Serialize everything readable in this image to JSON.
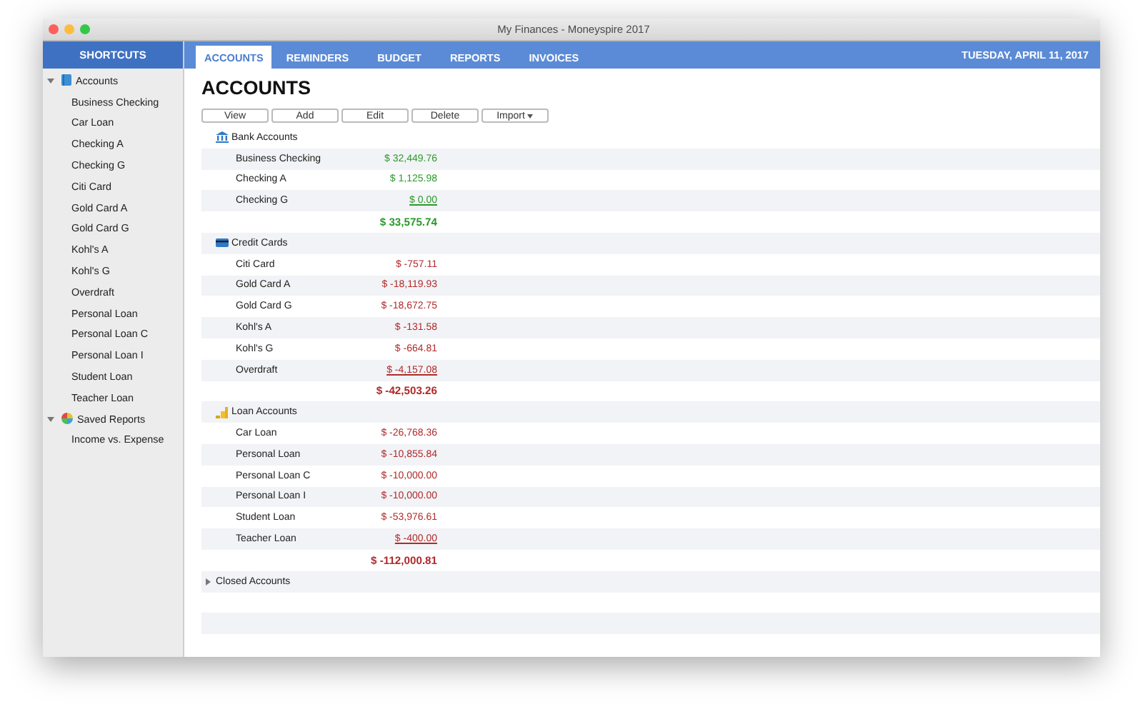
{
  "window": {
    "title": "My Finances - Moneyspire 2017"
  },
  "sidebar": {
    "header": "SHORTCUTS",
    "items": [
      {
        "label": "Accounts",
        "expanded": true,
        "children": [
          {
            "label": "Business Checking"
          },
          {
            "label": "Car Loan"
          },
          {
            "label": "Checking A"
          },
          {
            "label": "Checking G"
          },
          {
            "label": "Citi Card"
          },
          {
            "label": "Gold Card A"
          },
          {
            "label": "Gold Card G"
          },
          {
            "label": "Kohl's A"
          },
          {
            "label": "Kohl's G"
          },
          {
            "label": "Overdraft"
          },
          {
            "label": "Personal Loan"
          },
          {
            "label": "Personal Loan C"
          },
          {
            "label": "Personal Loan I"
          },
          {
            "label": "Student Loan"
          },
          {
            "label": "Teacher Loan"
          }
        ]
      },
      {
        "label": "Saved Reports",
        "expanded": true,
        "children": [
          {
            "label": "Income vs. Expense"
          }
        ]
      }
    ]
  },
  "tabs": [
    {
      "label": "ACCOUNTS",
      "selected": true
    },
    {
      "label": "REMINDERS",
      "selected": false
    },
    {
      "label": "BUDGET",
      "selected": false
    },
    {
      "label": "REPORTS",
      "selected": false
    },
    {
      "label": "INVOICES",
      "selected": false
    }
  ],
  "date": "TUESDAY, APRIL 11, 2017",
  "heading": "ACCOUNTS",
  "buttons": [
    {
      "label": "View",
      "kind": "plain"
    },
    {
      "label": "Add",
      "kind": "plain"
    },
    {
      "label": "Edit",
      "kind": "plain"
    },
    {
      "label": "Delete",
      "kind": "plain"
    },
    {
      "label": "Import",
      "kind": "menu"
    }
  ],
  "groups": [
    {
      "name": "Bank Accounts",
      "expanded": true,
      "total": "$ 33,575.74",
      "color": "#2a9a2a",
      "accounts": [
        {
          "name": "Business Checking",
          "amount": "$ 32,449.76",
          "underlined": false
        },
        {
          "name": "Checking A",
          "amount": "$ 1,125.98",
          "underlined": false
        },
        {
          "name": "Checking G",
          "amount": "$ 0.00",
          "underlined": true
        }
      ]
    },
    {
      "name": "Credit Cards",
      "expanded": true,
      "total": "$ -42,503.26",
      "color": "#b02a2a",
      "accounts": [
        {
          "name": "Citi Card",
          "amount": "$ -757.11",
          "underlined": false
        },
        {
          "name": "Gold Card A",
          "amount": "$ -18,119.93",
          "underlined": false
        },
        {
          "name": "Gold Card G",
          "amount": "$ -18,672.75",
          "underlined": false
        },
        {
          "name": "Kohl's A",
          "amount": "$ -131.58",
          "underlined": false
        },
        {
          "name": "Kohl's G",
          "amount": "$ -664.81",
          "underlined": false
        },
        {
          "name": "Overdraft",
          "amount": "$ -4,157.08",
          "underlined": true
        }
      ]
    },
    {
      "name": "Loan Accounts",
      "expanded": true,
      "total": "$ -112,000.81",
      "color": "#b02a2a",
      "accounts": [
        {
          "name": "Car Loan",
          "amount": "$ -26,768.36",
          "underlined": false
        },
        {
          "name": "Personal Loan",
          "amount": "$ -10,855.84",
          "underlined": false
        },
        {
          "name": "Personal Loan C",
          "amount": "$ -10,000.00",
          "underlined": false
        },
        {
          "name": "Personal Loan I",
          "amount": "$ -10,000.00",
          "underlined": false
        },
        {
          "name": "Student Loan",
          "amount": "$ -53,976.61",
          "underlined": false
        },
        {
          "name": "Teacher Loan",
          "amount": "$ -400.00",
          "underlined": true
        }
      ]
    },
    {
      "name": "Closed Accounts",
      "expanded": false
    }
  ]
}
